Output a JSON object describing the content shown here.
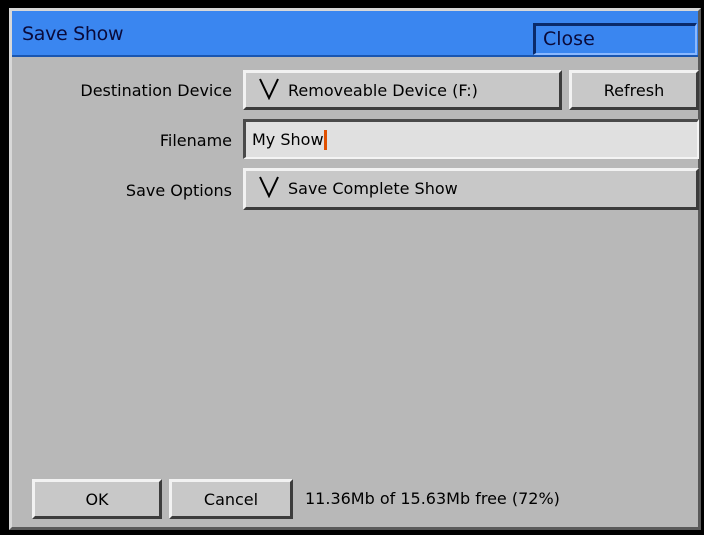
{
  "window": {
    "title": "Save Show",
    "close_label": "Close"
  },
  "destination": {
    "label": "Destination Device",
    "selected": "Removeable Device (F:)",
    "refresh_label": "Refresh"
  },
  "filename": {
    "label": "Filename",
    "value": "My Show"
  },
  "save_options": {
    "label": "Save Options",
    "selected": "Save Complete Show"
  },
  "footer": {
    "ok_label": "OK",
    "cancel_label": "Cancel",
    "status": "11.36Mb of 15.63Mb free (72%)"
  },
  "icons": {
    "dropdown": "chevron-down-icon"
  },
  "colors": {
    "titlebar": "#3a86f0",
    "panel": "#b8b8b8",
    "field": "#e0e0e0",
    "caret": "#e05000"
  }
}
